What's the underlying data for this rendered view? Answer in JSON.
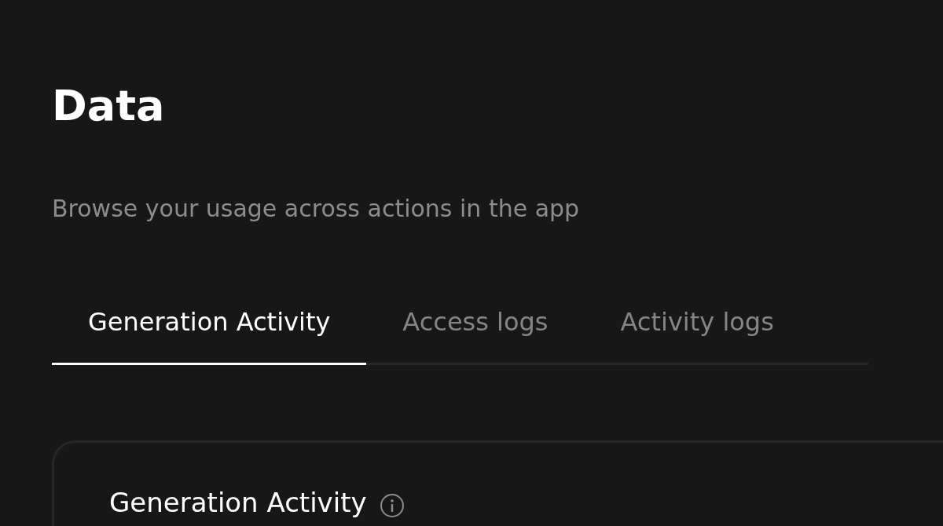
{
  "page": {
    "title": "Data",
    "subtitle": "Browse your usage across actions in the app"
  },
  "tabs": [
    {
      "label": "Generation Activity",
      "selected": true
    },
    {
      "label": "Access logs",
      "selected": false
    },
    {
      "label": "Activity logs",
      "selected": false
    }
  ],
  "card": {
    "title": "Generation Activity"
  }
}
